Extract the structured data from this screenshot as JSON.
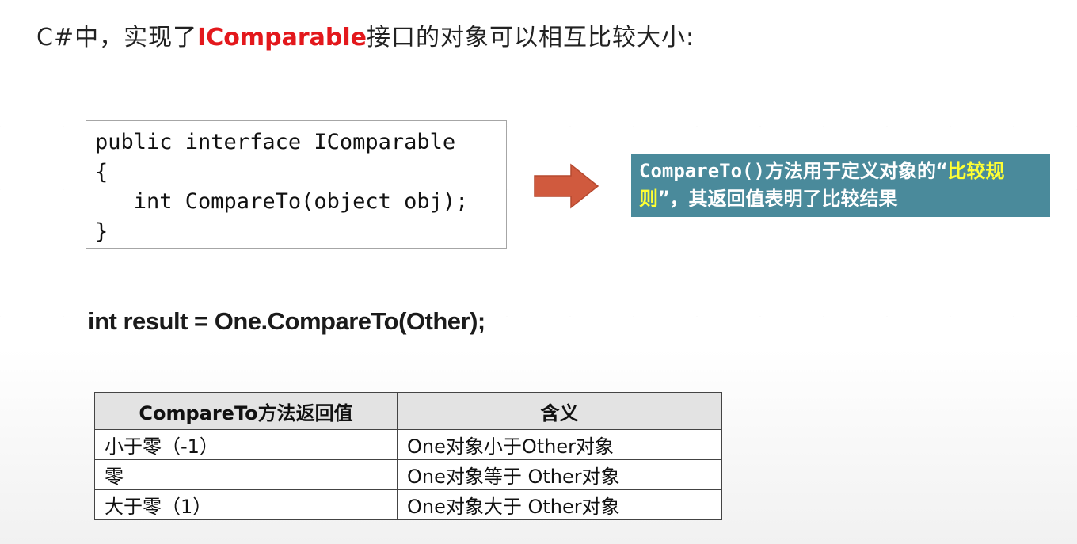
{
  "slide": {
    "title_prefix": "C#中，实现了",
    "title_highlight": "IComparable",
    "title_suffix": "接口的对象可以相互比较大小:",
    "code_lines": [
      "public interface IComparable",
      "{",
      "   int CompareTo(object obj);",
      "}"
    ],
    "note_part1": "CompareTo()方法用于定义对象的“",
    "note_highlight": "比较规则",
    "note_part2": "”，其返回值表明了比较结果",
    "result_line": "int result = One.CompareTo(Other);",
    "table": {
      "headers": [
        "CompareTo方法返回值",
        "含义"
      ],
      "rows": [
        [
          "小于零（-1）",
          "One对象小于Other对象"
        ],
        [
          "零",
          "One对象等于 Other对象"
        ],
        [
          "大于零（1）",
          "One对象大于 Other对象"
        ]
      ]
    },
    "colors": {
      "title_highlight": "#e3181c",
      "note_background": "#4a8a9b",
      "note_highlight": "#ffff33",
      "arrow": "#d05a3e"
    },
    "arrow_icon": "right-arrow-icon"
  }
}
